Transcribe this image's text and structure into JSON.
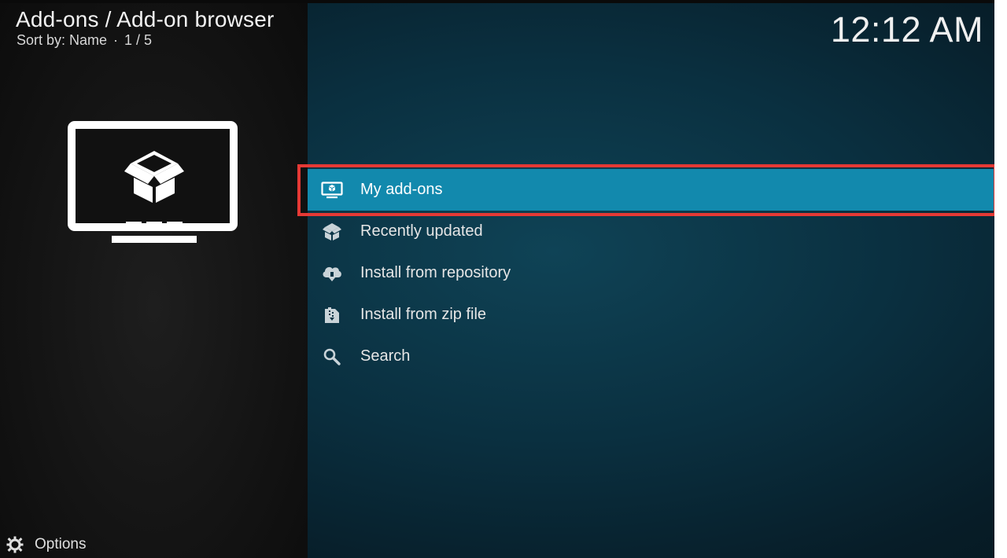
{
  "header": {
    "breadcrumb": "Add-ons / Add-on browser",
    "sort_label": "Sort by: Name",
    "separator": "·",
    "position": "1 / 5",
    "clock": "12:12 AM"
  },
  "hero": {
    "icon": "addon-box-monitor-icon"
  },
  "menu": {
    "items": [
      {
        "label": "My add-ons",
        "icon": "monitor-icon",
        "focused": true
      },
      {
        "label": "Recently updated",
        "icon": "box-icon",
        "focused": false
      },
      {
        "label": "Install from repository",
        "icon": "cloud-download-icon",
        "focused": false
      },
      {
        "label": "Install from zip file",
        "icon": "zip-icon",
        "focused": false
      },
      {
        "label": "Search",
        "icon": "search-icon",
        "focused": false
      }
    ]
  },
  "footer": {
    "options_label": "Options",
    "icon": "options-icon"
  },
  "colors": {
    "focus": "#1289ad",
    "annotation": "#e53935",
    "background": "#0a2f3f",
    "panel": "#141414"
  }
}
